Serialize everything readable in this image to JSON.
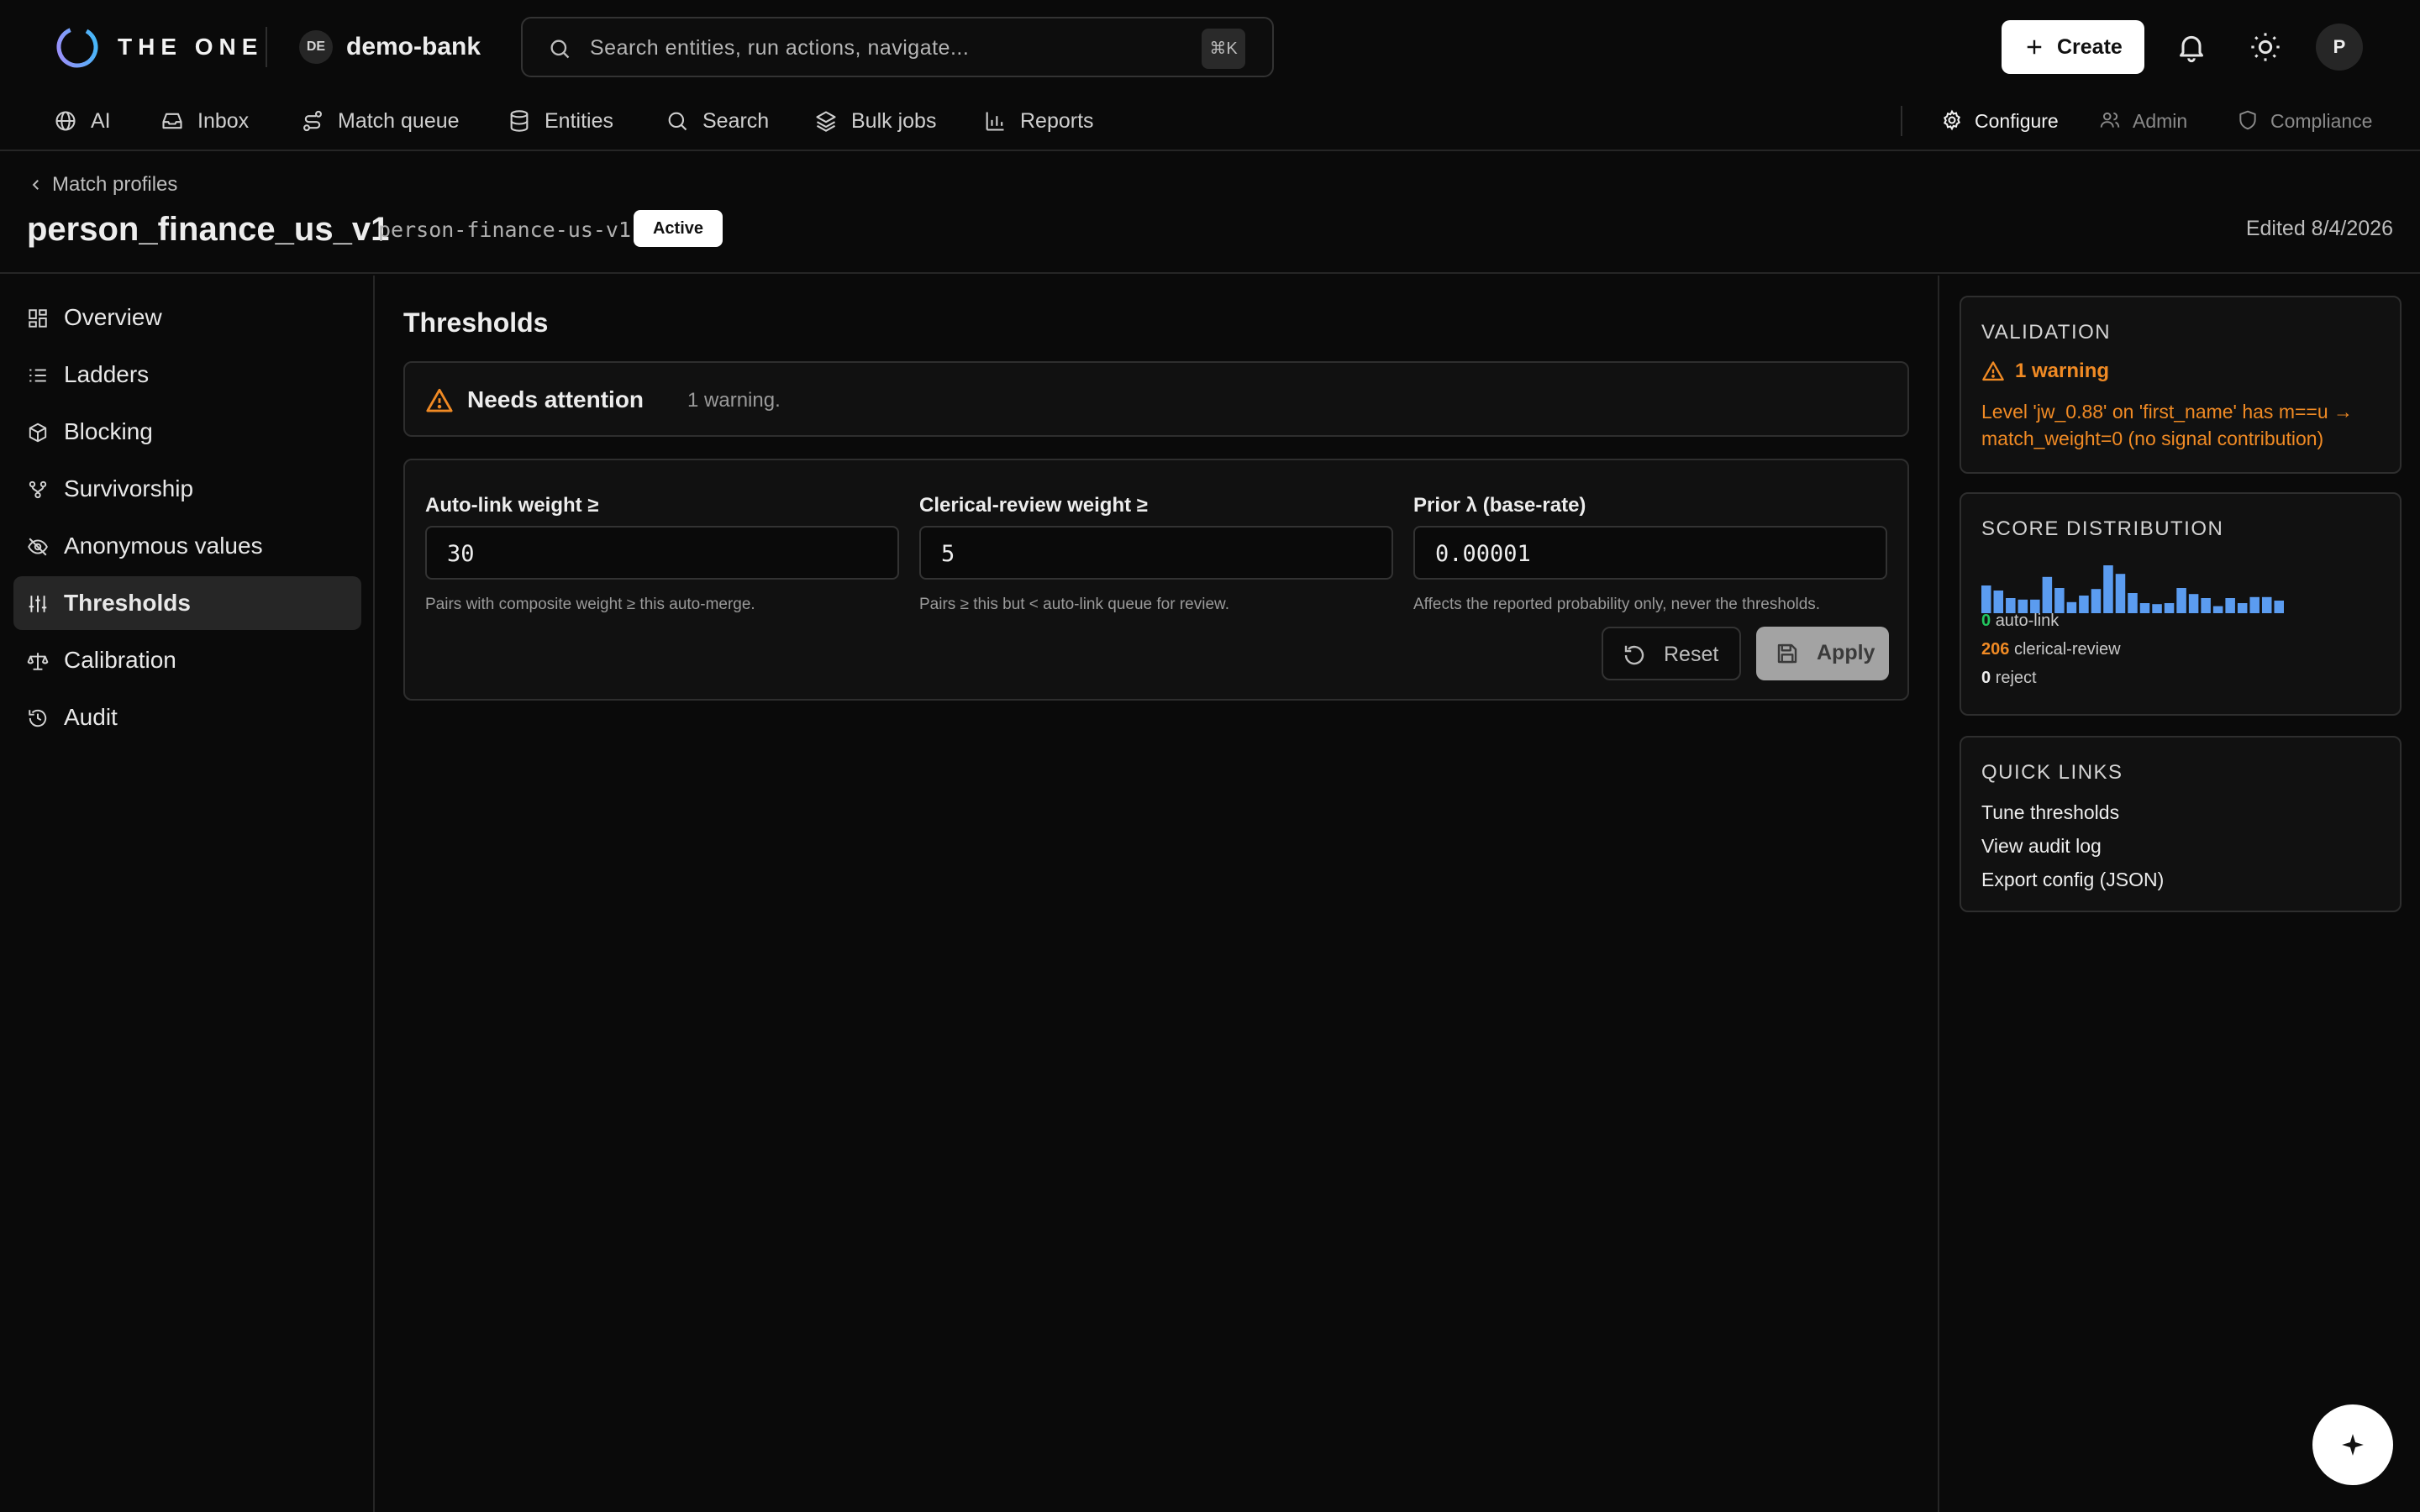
{
  "app": {
    "brand": "THE ONE",
    "workspace_badge": "DE",
    "workspace_name": "demo-bank"
  },
  "search": {
    "placeholder": "Search entities, run actions, navigate...",
    "shortcut": "⌘K"
  },
  "header_actions": {
    "create_label": "Create",
    "avatar_initial": "P"
  },
  "nav": {
    "items": [
      {
        "label": "AI",
        "icon": "globe-icon"
      },
      {
        "label": "Inbox",
        "icon": "inbox-icon"
      },
      {
        "label": "Match queue",
        "icon": "route-icon"
      },
      {
        "label": "Entities",
        "icon": "database-icon"
      },
      {
        "label": "Search",
        "icon": "search-icon"
      },
      {
        "label": "Bulk jobs",
        "icon": "layers-icon"
      },
      {
        "label": "Reports",
        "icon": "bar-chart-icon"
      }
    ],
    "right": [
      {
        "label": "Configure",
        "icon": "gear-icon",
        "active": true
      },
      {
        "label": "Admin",
        "icon": "users-icon"
      },
      {
        "label": "Compliance",
        "icon": "shield-icon"
      }
    ]
  },
  "page": {
    "breadcrumb": "Match profiles",
    "title": "person_finance_us_v1",
    "slug": "person-finance-us-v1",
    "status": "Active",
    "edited": "Edited 8/4/2026"
  },
  "sidebar": {
    "items": [
      {
        "label": "Overview",
        "icon": "grid-icon"
      },
      {
        "label": "Ladders",
        "icon": "list-ordered-icon"
      },
      {
        "label": "Blocking",
        "icon": "box-icon"
      },
      {
        "label": "Survivorship",
        "icon": "git-merge-icon"
      },
      {
        "label": "Anonymous values",
        "icon": "eye-off-icon"
      },
      {
        "label": "Thresholds",
        "icon": "sliders-icon",
        "active": true
      },
      {
        "label": "Calibration",
        "icon": "scale-icon"
      },
      {
        "label": "Audit",
        "icon": "history-icon"
      }
    ]
  },
  "thresholds": {
    "title": "Thresholds",
    "alert": {
      "title": "Needs attention",
      "text": "1 warning."
    },
    "fields": [
      {
        "label": "Auto-link weight ≥",
        "value": "30",
        "help": "Pairs with composite weight ≥ this auto-merge."
      },
      {
        "label": "Clerical-review weight ≥",
        "value": "5",
        "help": "Pairs ≥ this but < auto-link queue for review."
      },
      {
        "label": "Prior λ (base-rate)",
        "value": "0.00001",
        "help": "Affects the reported probability only, never the thresholds."
      }
    ],
    "reset_label": "Reset",
    "apply_label": "Apply"
  },
  "validation": {
    "title": "VALIDATION",
    "warning_count": "1 warning",
    "message": "Level 'jw_0.88' on 'first_name' has m==u → match_weight=0 (no signal contribution)"
  },
  "score_distribution": {
    "title": "SCORE DISTRIBUTION",
    "bars": [
      0.55,
      0.45,
      0.3,
      0.27,
      0.27,
      0.72,
      0.5,
      0.22,
      0.35,
      0.48,
      0.95,
      0.78,
      0.4,
      0.2,
      0.18,
      0.2,
      0.5,
      0.38,
      0.3,
      0.14,
      0.3,
      0.2,
      0.32,
      0.32,
      0.25
    ],
    "stats": [
      {
        "count": "0",
        "label": "auto-link",
        "color": "#22c55e"
      },
      {
        "count": "206",
        "label": "clerical-review",
        "color": "#f08a24"
      },
      {
        "count": "0",
        "label": "reject",
        "color": "#ededed"
      }
    ]
  },
  "quick_links": {
    "title": "QUICK LINKS",
    "items": [
      "Tune thresholds",
      "View audit log",
      "Export config (JSON)"
    ]
  },
  "colors": {
    "accent_bar": "#5b9cf0",
    "warning": "#f08a24",
    "success": "#22c55e"
  }
}
